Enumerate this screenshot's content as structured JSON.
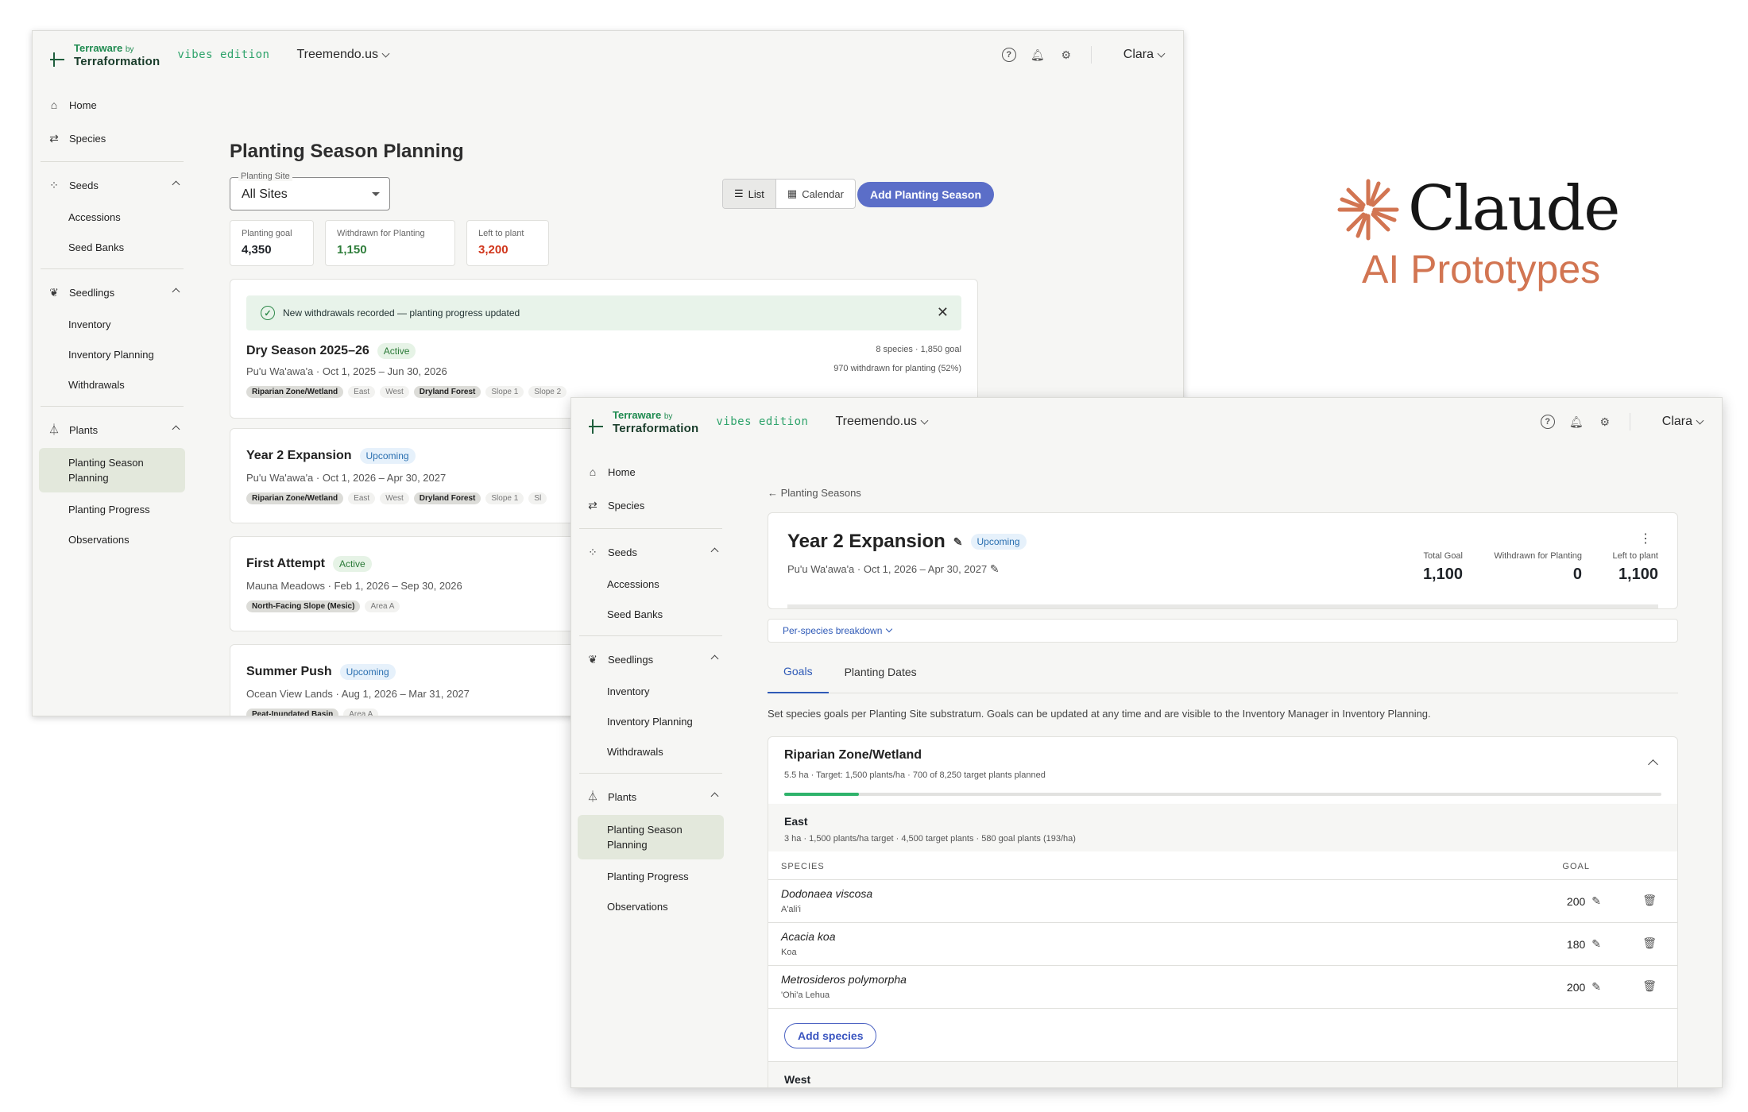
{
  "app": {
    "logo_top": "Terraware",
    "logo_by": "by",
    "logo_bottom": "Terraformation",
    "edition": "vibes edition",
    "org": "Treemendo.us",
    "user": "Clara"
  },
  "sidebar": {
    "home": "Home",
    "species": "Species",
    "seeds": "Seeds",
    "accessions": "Accessions",
    "seed_banks": "Seed Banks",
    "seedlings": "Seedlings",
    "inventory": "Inventory",
    "inventory_planning": "Inventory Planning",
    "withdrawals": "Withdrawals",
    "plants": "Plants",
    "planting_season_planning_1": "Planting Season",
    "planting_season_planning_2": "Planning",
    "planting_progress": "Planting Progress",
    "observations": "Observations"
  },
  "list_page": {
    "title": "Planting Season Planning",
    "site_select_label": "Planting Site",
    "site_select_value": "All Sites",
    "view_list": "List",
    "view_calendar": "Calendar",
    "add_button": "Add Planting Season",
    "stats": [
      {
        "label": "Planting goal",
        "value": "4,350",
        "color": "#222222"
      },
      {
        "label": "Withdrawn for Planting",
        "value": "1,150",
        "color": "#2e7d3a"
      },
      {
        "label": "Left to plant",
        "value": "3,200",
        "color": "#d0361c"
      }
    ],
    "banner": "New withdrawals recorded — planting progress updated",
    "seasons": [
      {
        "name": "Dry Season 2025–26",
        "status": "Active",
        "site_dates": "Pu'u Wa'awa'a · Oct 1, 2025 – Jun 30, 2026",
        "tags": [
          {
            "t": "Riparian Zone/Wetland",
            "dark": true
          },
          {
            "t": "East",
            "dark": false
          },
          {
            "t": "West",
            "dark": false
          },
          {
            "t": "Dryland Forest",
            "dark": true
          },
          {
            "t": "Slope 1",
            "dark": false
          },
          {
            "t": "Slope 2",
            "dark": false
          }
        ],
        "summary": "8 species · 1,850 goal",
        "withdrawn": "970 withdrawn for planting (52%)"
      },
      {
        "name": "Year 2 Expansion",
        "status": "Upcoming",
        "site_dates": "Pu'u Wa'awa'a · Oct 1, 2026 – Apr 30, 2027",
        "tags": [
          {
            "t": "Riparian Zone/Wetland",
            "dark": true
          },
          {
            "t": "East",
            "dark": false
          },
          {
            "t": "West",
            "dark": false
          },
          {
            "t": "Dryland Forest",
            "dark": true
          },
          {
            "t": "Slope 1",
            "dark": false
          },
          {
            "t": "Sl",
            "dark": false
          }
        ]
      },
      {
        "name": "First Attempt",
        "status": "Active",
        "site_dates": "Mauna Meadows · Feb 1, 2026 – Sep 30, 2026",
        "tags": [
          {
            "t": "North-Facing Slope (Mesic)",
            "dark": true
          },
          {
            "t": "Area A",
            "dark": false
          }
        ]
      },
      {
        "name": "Summer Push",
        "status": "Upcoming",
        "site_dates": "Ocean View Lands · Aug 1, 2026 – Mar 31, 2027",
        "tags": [
          {
            "t": "Peat-Inundated Basin",
            "dark": true
          },
          {
            "t": "Area A",
            "dark": false
          }
        ]
      }
    ]
  },
  "detail_page": {
    "back": "Planting Seasons",
    "title": "Year 2 Expansion",
    "status": "Upcoming",
    "site_dates": "Pu'u Wa'awa'a · Oct 1, 2026 – Apr 30, 2027",
    "kpis": [
      {
        "label": "Total Goal",
        "value": "1,100"
      },
      {
        "label": "Withdrawn for Planting",
        "value": "0"
      },
      {
        "label": "Left to plant",
        "value": "1,100"
      }
    ],
    "breakdown": "Per-species breakdown",
    "tabs": [
      "Goals",
      "Planting Dates"
    ],
    "description": "Set species goals per Planting Site substratum. Goals can be updated at any time and are visible to the Inventory Manager in Inventory Planning.",
    "zone": {
      "title": "Riparian Zone/Wetland",
      "subtitle": "5.5 ha · Target: 1,500 plants/ha · 700 of 8,250 target plants planned",
      "progress": 0.085,
      "sub_title": "East",
      "sub_subtitle": "3 ha · 1,500 plants/ha target · 4,500 target plants · 580 goal plants (193/ha)",
      "col_species": "SPECIES",
      "col_goal": "GOAL",
      "rows": [
        {
          "species": "Dodonaea viscosa",
          "common": "A'ali'i",
          "goal": "200"
        },
        {
          "species": "Acacia koa",
          "common": "Koa",
          "goal": "180"
        },
        {
          "species": "Metrosideros polymorpha",
          "common": "'Ohi'a Lehua",
          "goal": "200"
        }
      ],
      "add_species": "Add species",
      "next_sub": "West"
    }
  },
  "brand": {
    "name": "Claude",
    "tagline": "AI Prototypes",
    "color": "#d27552"
  }
}
